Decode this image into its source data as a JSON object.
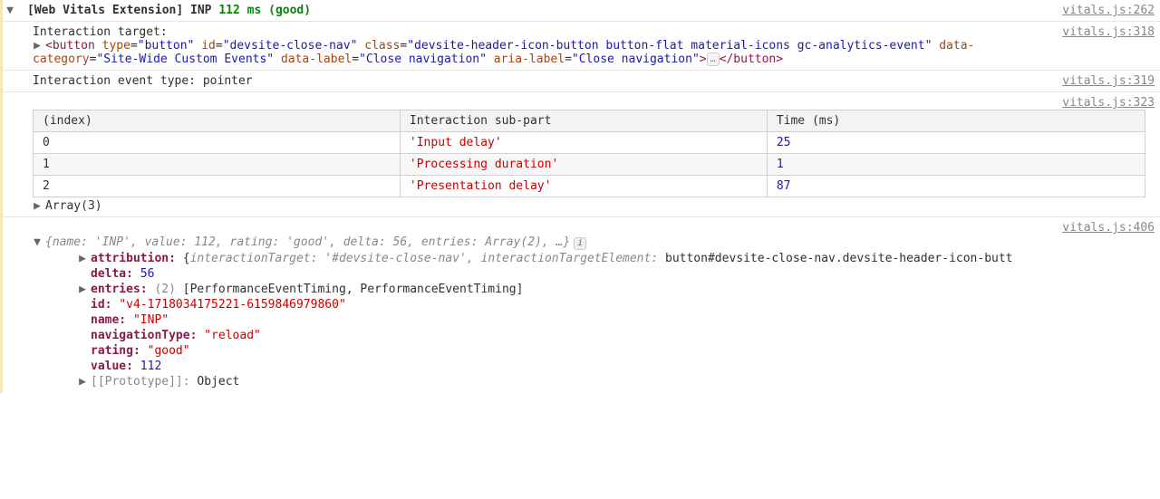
{
  "header": {
    "prefix": "[Web Vitals Extension] INP",
    "value": "112 ms",
    "rating": "(good)",
    "source": "vitals.js:262"
  },
  "targetRow": {
    "label": "Interaction target:",
    "source": "vitals.js:318",
    "node": {
      "open": "<",
      "tag": "button",
      "attrs": [
        {
          "n": "type",
          "v": "\"button\""
        },
        {
          "n": "id",
          "v": "\"devsite-close-nav\""
        },
        {
          "n": "class",
          "v": "\"devsite-header-icon-button button-flat material-icons gc-analytics-event\""
        },
        {
          "n": "data-category",
          "v": "\"Site-Wide Custom Events\""
        },
        {
          "n": "data-label",
          "v": "\"Close navigation\""
        },
        {
          "n": "aria-label",
          "v": "\"Close navigation\""
        }
      ],
      "ellipsis": "…",
      "closeTag": "</button>"
    }
  },
  "eventTypeRow": {
    "text": "Interaction event type: pointer",
    "source": "vitals.js:319"
  },
  "tableRow": {
    "source": "vitals.js:323",
    "headers": [
      "(index)",
      "Interaction sub-part",
      "Time (ms)"
    ],
    "rows": [
      {
        "idx": "0",
        "part": "'Input delay'",
        "time": "25"
      },
      {
        "idx": "1",
        "part": "'Processing duration'",
        "time": "1"
      },
      {
        "idx": "2",
        "part": "'Presentation delay'",
        "time": "87"
      }
    ],
    "arrayLabel": "Array(3)"
  },
  "objRow": {
    "source": "vitals.js:406",
    "summary": "{name: 'INP', value: 112, rating: 'good', delta: 56, entries: Array(2), …}",
    "attribution": {
      "key": "attribution:",
      "preview": "{",
      "p1k": "interactionTarget:",
      "p1v": " '#devsite-close-nav'",
      "sep": ", ",
      "p2k": "interactionTargetElement:",
      "p2v": " button#devsite-close-nav.devsite-header-icon-butt"
    },
    "delta": {
      "k": "delta:",
      "v": " 56"
    },
    "entries": {
      "k": "entries:",
      "count": " (2) ",
      "v": "[PerformanceEventTiming, PerformanceEventTiming]"
    },
    "id": {
      "k": "id:",
      "v": " \"v4-1718034175221-6159846979860\""
    },
    "name": {
      "k": "name:",
      "v": " \"INP\""
    },
    "navType": {
      "k": "navigationType:",
      "v": " \"reload\""
    },
    "rating": {
      "k": "rating:",
      "v": " \"good\""
    },
    "value": {
      "k": "value:",
      "v": " 112"
    },
    "proto": {
      "k": "[[Prototype]]:",
      "v": " Object"
    }
  }
}
